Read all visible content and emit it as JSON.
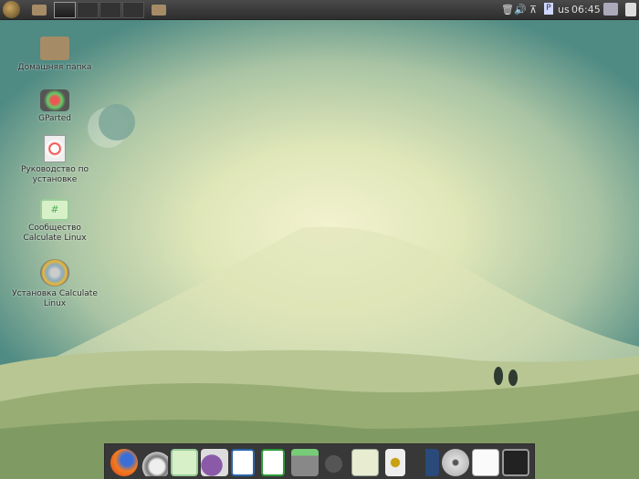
{
  "panel": {
    "workspaces": 4,
    "active_workspace": 1,
    "keyboard_layout": "us",
    "clock": "06:45"
  },
  "desktop_icons": [
    {
      "label": "Домашняя папка",
      "icon": "home-folder-icon"
    },
    {
      "label": "GParted",
      "icon": "gparted-icon"
    },
    {
      "label": "Руководство по установке",
      "icon": "help-lifebuoy-icon"
    },
    {
      "label": "Сообщество Calculate Linux",
      "icon": "chat-hashtag-icon"
    },
    {
      "label": "Установка Calculate Linux",
      "icon": "install-disc-icon"
    }
  ],
  "dock": [
    "firefox-icon",
    "mail-clock-icon",
    "chat-icon",
    "pidgin-icon",
    "writer-icon",
    "calc-spreadsheet-icon",
    "calculator-icon",
    "gimp-icon",
    "image-viewer-icon",
    "audio-player-icon",
    "sound-mixer-icon",
    "disc-burner-icon",
    "text-editor-icon",
    "terminal-icon"
  ]
}
